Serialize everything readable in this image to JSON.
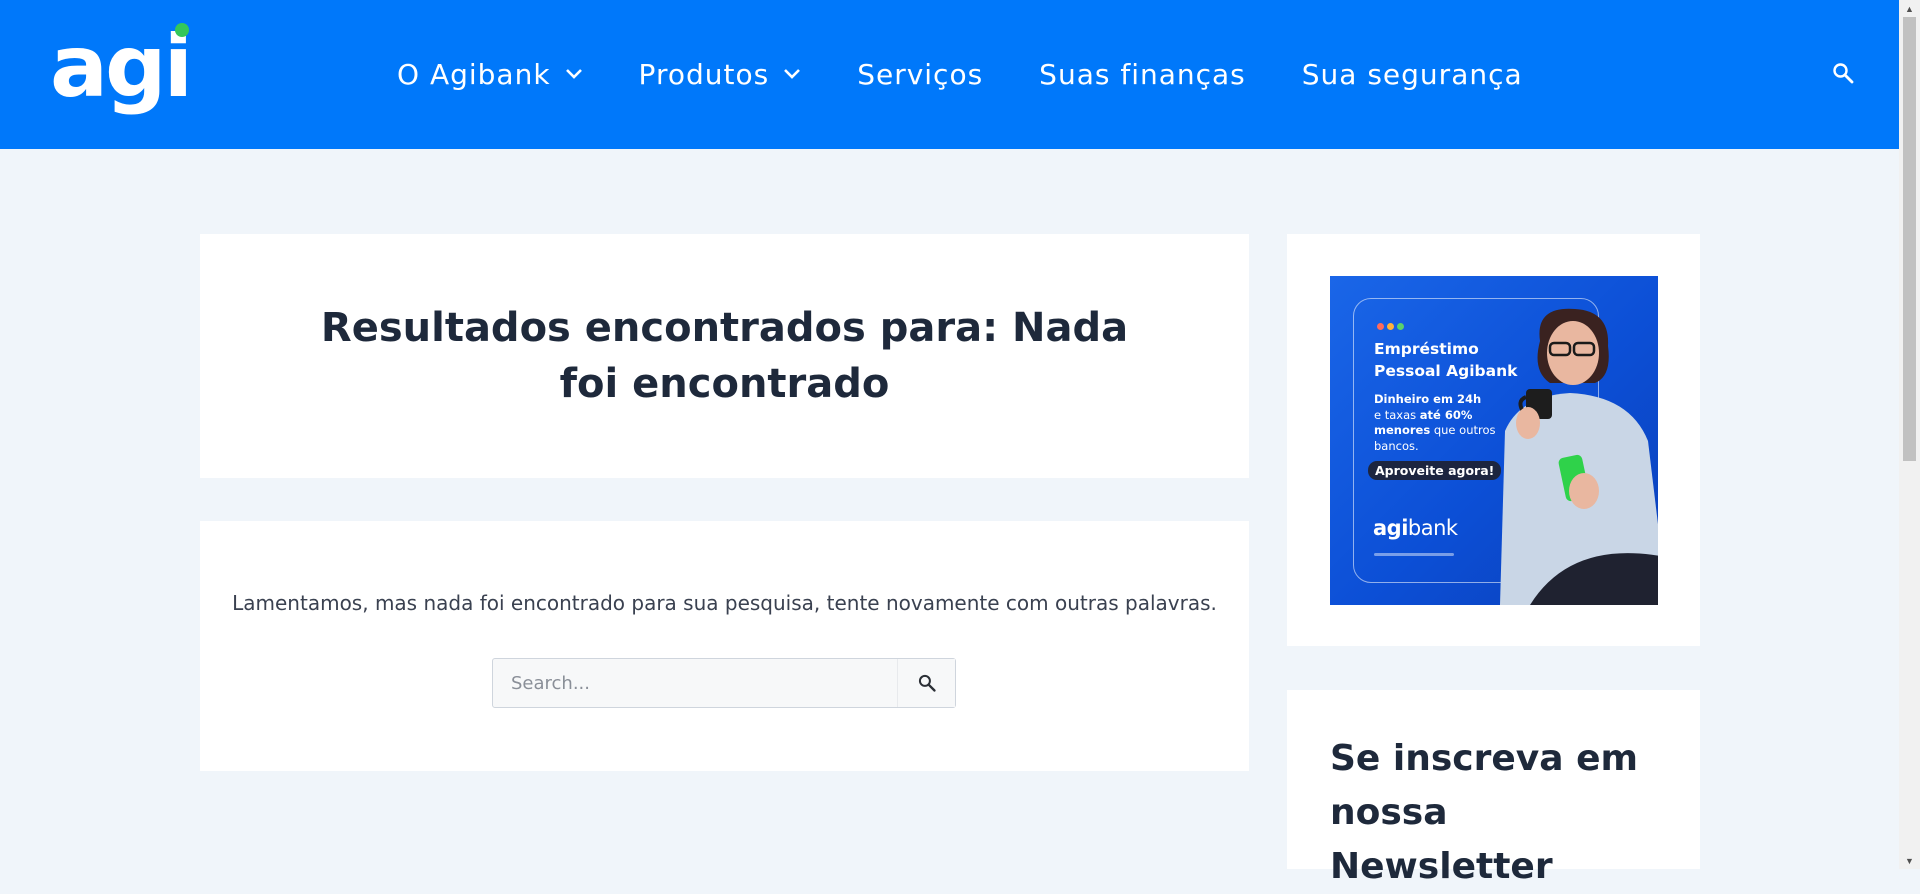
{
  "header": {
    "logo_text": "agi",
    "nav": [
      {
        "label": "O Agibank",
        "has_dropdown": true
      },
      {
        "label": "Produtos",
        "has_dropdown": true
      },
      {
        "label": "Serviços",
        "has_dropdown": false
      },
      {
        "label": "Suas finanças",
        "has_dropdown": false
      },
      {
        "label": "Sua segurança",
        "has_dropdown": false
      }
    ],
    "search_icon": "search-icon",
    "brand_color": "#0078fa",
    "logo_dot_color": "#34c759"
  },
  "main": {
    "title": "Resultados encontrados para: Nada foi encontrado",
    "message": "Lamentamos, mas nada foi encontrado para sua pesquisa, tente novamente com outras palavras.",
    "search": {
      "placeholder": "Search...",
      "value": "",
      "submit_icon": "search-icon"
    }
  },
  "sidebar": {
    "ad": {
      "title": "Empréstimo Pessoal Agibank",
      "line1": "Dinheiro em 24h",
      "line2_prefix": "e taxas ",
      "line2_bold": "até 60%",
      "line3_bold": "menores",
      "line3_suffix": " que outros",
      "line4": "bancos.",
      "cta": "Aproveite agora!",
      "logo_light": "agi",
      "logo_regular": "bank",
      "dot_colors": [
        "#ff6b5b",
        "#ffb23b",
        "#5ad16b"
      ]
    },
    "newsletter": {
      "title": "Se inscreva em nossa Newsletter"
    }
  }
}
